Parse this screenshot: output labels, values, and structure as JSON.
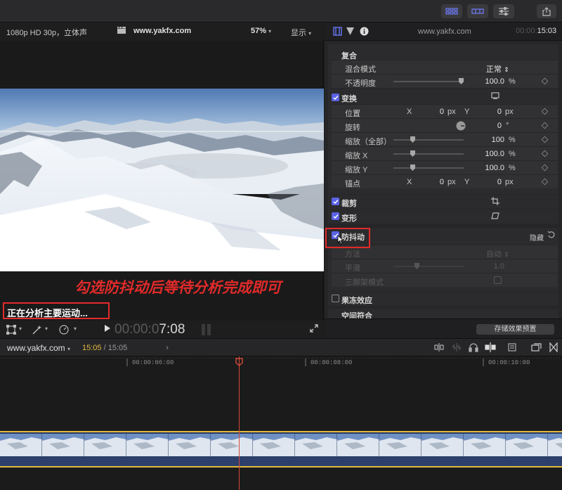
{
  "viewer": {
    "format": "1080p HD 30p，立体声",
    "title": "www.yakfx.com",
    "zoom": "57%",
    "display": "显示",
    "annotation": "勾选防抖动后等待分析完成即可",
    "analyzing": "正在分析主要运动...",
    "timecode_dim": "00:00:0",
    "timecode_bright": "7:08"
  },
  "inspector": {
    "site": "www.yakfx.com",
    "timecode_dim": "00:00:",
    "timecode": "15:03",
    "composite": {
      "title": "复合",
      "blend_label": "混合模式",
      "blend_value": "正常",
      "opacity_label": "不透明度",
      "opacity_value": "100.0",
      "opacity_unit": "%"
    },
    "transform": {
      "title": "变换",
      "position_label": "位置",
      "rotation_label": "旋转",
      "scale_all_label": "缩放（全部）",
      "scale_x_label": "缩放 X",
      "scale_y_label": "缩放 Y",
      "anchor_label": "锚点",
      "x_label": "X",
      "y_label": "Y",
      "zero": "0",
      "px": "px",
      "deg": "°",
      "pct": "%",
      "hundred": "100",
      "hundred_dec": "100.0"
    },
    "crop": {
      "title": "裁剪"
    },
    "distort": {
      "title": "变形"
    },
    "stabilization": {
      "title": "防抖动",
      "hide": "隐藏",
      "method_label": "方法",
      "method_value": "自动",
      "smooth_label": "平滑",
      "smooth_value": "1.0",
      "tripod_label": "三脚架模式"
    },
    "freeze": {
      "title": "果冻效应"
    },
    "spatial": {
      "title": "空间符合"
    },
    "save_preset": "存储效果预置"
  },
  "timeline": {
    "title": "www.yakfx.com",
    "time_current": "15:05",
    "time_sep": " / ",
    "time_total": "15:05",
    "ruler": [
      "00:00:06:00",
      "00:00:08:00",
      "00:00:10:00"
    ]
  }
}
